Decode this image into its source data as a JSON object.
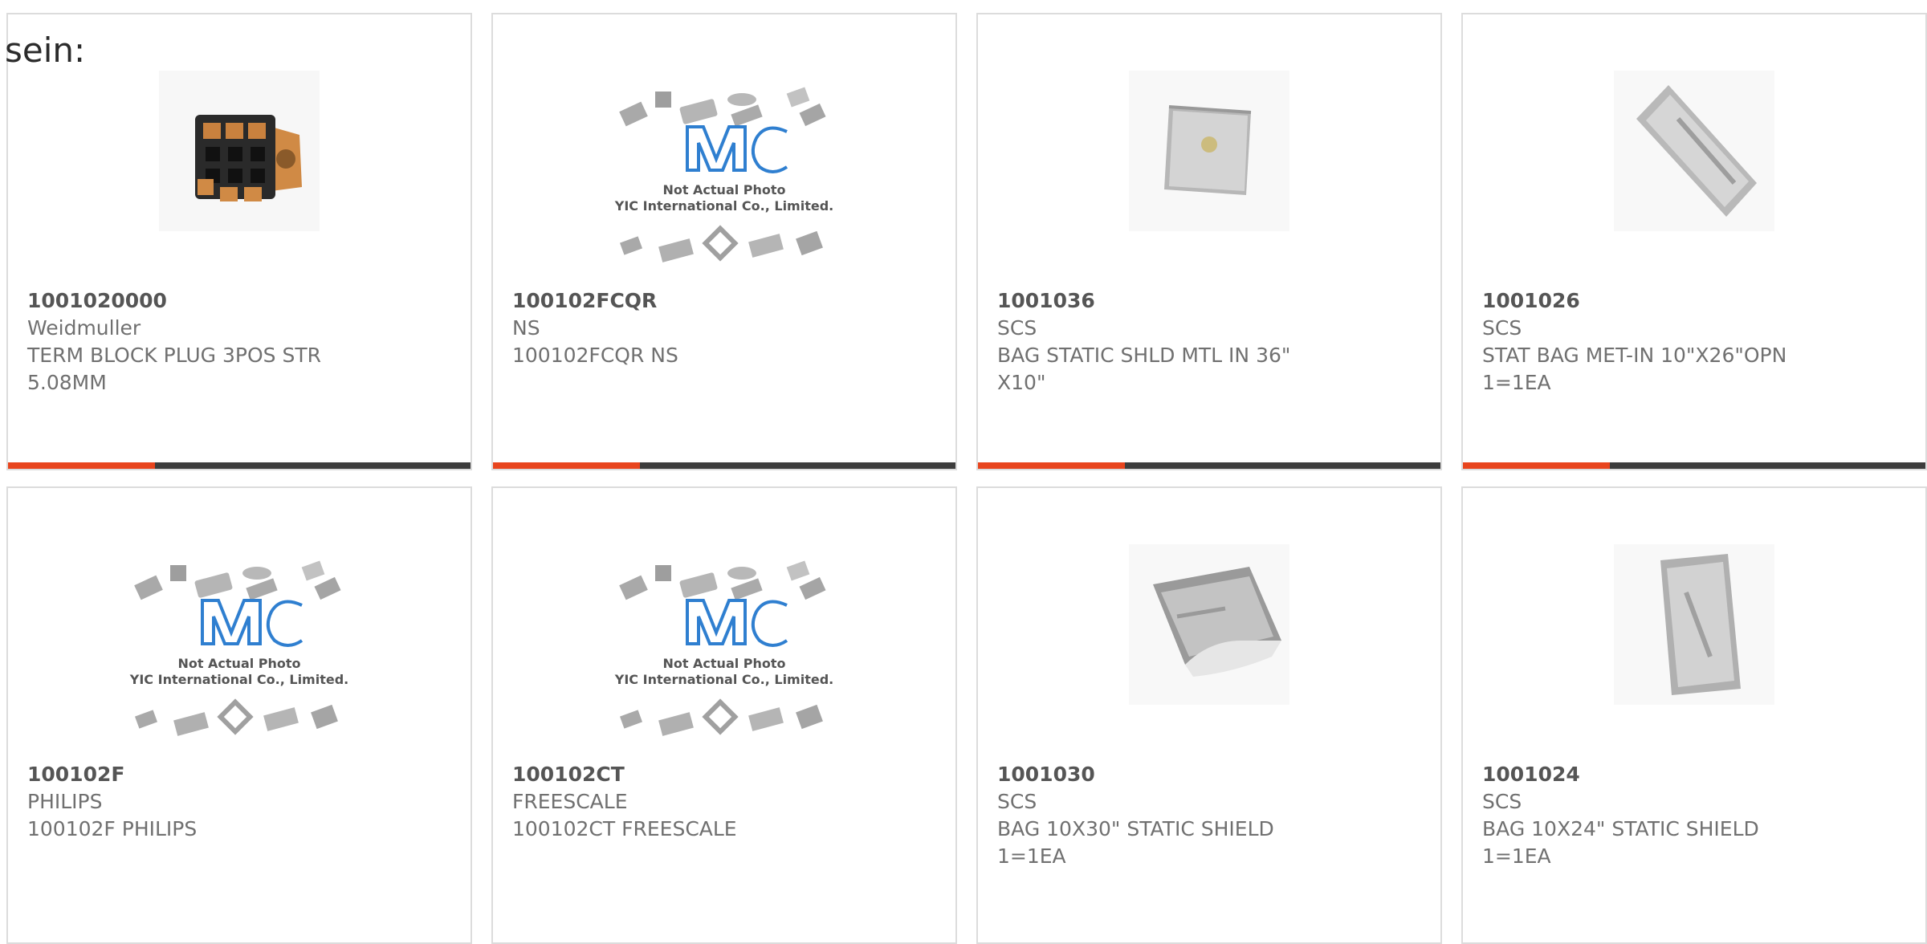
{
  "page": {
    "heading": "sein:"
  },
  "products": [
    {
      "part_number": "1001020000",
      "manufacturer": "Weidmuller",
      "description": "TERM BLOCK PLUG 3POS STR 5.08MM",
      "image": "terminal-block-photo"
    },
    {
      "part_number": "100102FCQR",
      "manufacturer": "NS",
      "description": "100102FCQR NS",
      "image": "placeholder-image",
      "image_caption_1": "Not Actual Photo",
      "image_caption_2": "YIC International Co., Limited."
    },
    {
      "part_number": "1001036",
      "manufacturer": "SCS",
      "description": "BAG STATIC SHLD MTL IN 36\" X10\"",
      "image": "static-bag-photo"
    },
    {
      "part_number": "1001026",
      "manufacturer": "SCS",
      "description": "STAT BAG MET-IN 10\"X26\"OPN 1=1EA",
      "image": "static-bag-photo"
    },
    {
      "part_number": "100102F",
      "manufacturer": "PHILIPS",
      "description": "100102F PHILIPS",
      "image": "placeholder-image",
      "image_caption_1": "Not Actual Photo",
      "image_caption_2": "YIC International Co., Limited."
    },
    {
      "part_number": "100102CT",
      "manufacturer": "FREESCALE",
      "description": "100102CT FREESCALE",
      "image": "placeholder-image",
      "image_caption_1": "Not Actual Photo",
      "image_caption_2": "YIC International Co., Limited."
    },
    {
      "part_number": "1001030",
      "manufacturer": "SCS",
      "description": "BAG 10X30\" STATIC SHIELD 1=1EA",
      "image": "static-bag-photo"
    },
    {
      "part_number": "1001024",
      "manufacturer": "SCS",
      "description": "BAG 10X24\" STATIC SHIELD 1=1EA",
      "image": "static-bag-photo"
    }
  ],
  "colors": {
    "accent": "#e8451e",
    "bar": "#3d3d3d",
    "border": "#dcdcdc",
    "text": "#707070",
    "logo": "#2f7fd0"
  }
}
